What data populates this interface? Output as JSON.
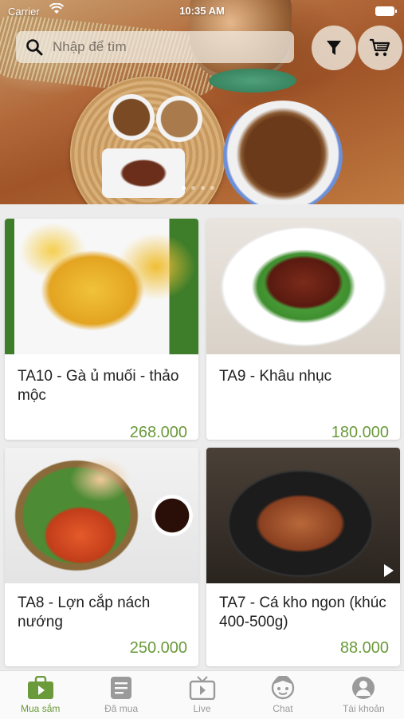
{
  "status_bar": {
    "carrier": "Carrier",
    "time": "10:35 AM"
  },
  "search": {
    "placeholder": "Nhập để tìm"
  },
  "banner": {
    "dots": 4,
    "active_dot": 0
  },
  "products": [
    {
      "title": "TA10 - Gà ủ muối - thảo mộc",
      "price": "268.000"
    },
    {
      "title": "TA9 - Khâu nhục",
      "price": "180.000"
    },
    {
      "title": "TA8 - Lợn cắp nách nướng",
      "price": "250.000"
    },
    {
      "title": "TA7 - Cá kho ngon (khúc 400-500g)",
      "price": "88.000"
    }
  ],
  "tabs": [
    {
      "label": "Mua sắm",
      "icon": "shop-icon",
      "active": true
    },
    {
      "label": "Đã mua",
      "icon": "orders-icon",
      "active": false
    },
    {
      "label": "Live",
      "icon": "tv-icon",
      "active": false
    },
    {
      "label": "Chat",
      "icon": "chat-icon",
      "active": false
    },
    {
      "label": "Tài khoản",
      "icon": "account-icon",
      "active": false
    }
  ],
  "colors": {
    "accent": "#6a9a3a",
    "tab_inactive": "#9a9a9a"
  }
}
